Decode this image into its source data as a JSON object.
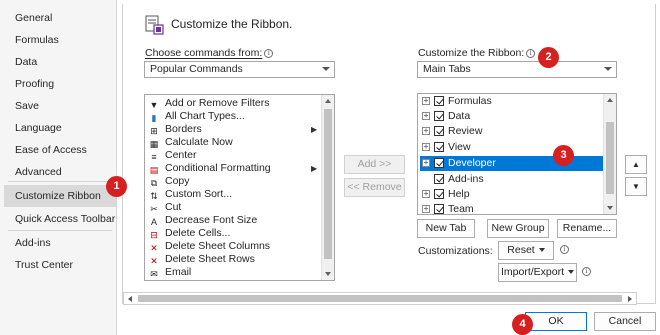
{
  "nav": {
    "items": [
      {
        "label": "General"
      },
      {
        "label": "Formulas"
      },
      {
        "label": "Data"
      },
      {
        "label": "Proofing"
      },
      {
        "label": "Save"
      },
      {
        "label": "Language"
      },
      {
        "label": "Ease of Access"
      },
      {
        "label": "Advanced"
      },
      {
        "label": "Customize Ribbon"
      },
      {
        "label": "Quick Access Toolbar"
      },
      {
        "label": "Add-ins"
      },
      {
        "label": "Trust Center"
      }
    ]
  },
  "header": {
    "title": "Customize the Ribbon."
  },
  "left": {
    "label": "Choose commands from:",
    "selected": "Popular Commands",
    "commands": [
      {
        "label": "Add or Remove Filters",
        "icon": "filter-icon"
      },
      {
        "label": "All Chart Types...",
        "icon": "chart-icon"
      },
      {
        "label": "Borders",
        "icon": "borders-icon"
      },
      {
        "label": "Calculate Now",
        "icon": "calculate-icon"
      },
      {
        "label": "Center",
        "icon": "center-icon"
      },
      {
        "label": "Conditional Formatting",
        "icon": "conditional-formatting-icon"
      },
      {
        "label": "Copy",
        "icon": "copy-icon"
      },
      {
        "label": "Custom Sort...",
        "icon": "sort-icon"
      },
      {
        "label": "Cut",
        "icon": "cut-icon"
      },
      {
        "label": "Decrease Font Size",
        "icon": "decrease-font-icon"
      },
      {
        "label": "Delete Cells...",
        "icon": "delete-cells-icon"
      },
      {
        "label": "Delete Sheet Columns",
        "icon": "delete-columns-icon"
      },
      {
        "label": "Delete Sheet Rows",
        "icon": "delete-rows-icon"
      },
      {
        "label": "Email",
        "icon": "email-icon"
      }
    ]
  },
  "middle": {
    "add_label": "Add >>",
    "remove_label": "<< Remove"
  },
  "right": {
    "label": "Customize the Ribbon:",
    "selected": "Main Tabs",
    "tabs": [
      {
        "label": "Formulas"
      },
      {
        "label": "Data"
      },
      {
        "label": "Review"
      },
      {
        "label": "View"
      },
      {
        "label": "Developer"
      },
      {
        "label": "Add-ins"
      },
      {
        "label": "Help"
      },
      {
        "label": "Team"
      }
    ],
    "new_tab": "New Tab",
    "new_group": "New Group",
    "rename": "Rename...",
    "customizations_label": "Customizations:",
    "reset": "Reset",
    "import_export": "Import/Export"
  },
  "badges": [
    "1",
    "2",
    "3",
    "4"
  ],
  "footer": {
    "ok": "OK",
    "cancel": "Cancel"
  },
  "colors": {
    "accent": "#0078d7",
    "badge": "#d61f1f",
    "nav_selected": "#d9d9d9"
  }
}
